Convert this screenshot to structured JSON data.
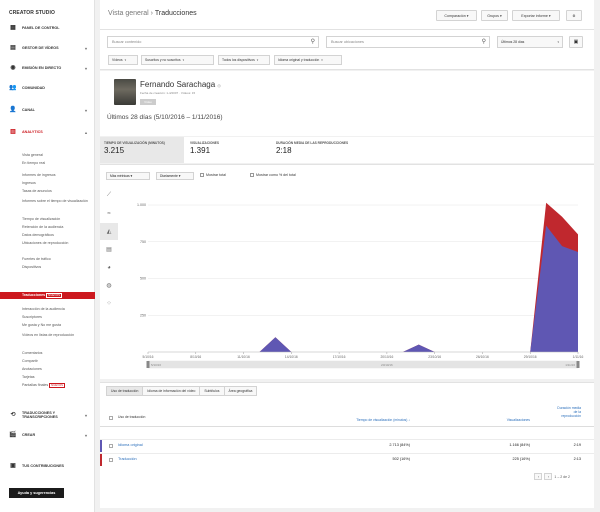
{
  "app": {
    "title": "CREATOR STUDIO"
  },
  "sidebar": {
    "nav": [
      {
        "label": "PANEL DE CONTROL",
        "icon": "dashboard-icon",
        "glyph": "▦"
      },
      {
        "label": "GESTOR DE VÍDEOS",
        "icon": "video-manager-icon",
        "glyph": "▤"
      },
      {
        "label": "EMISIÓN EN DIRECTO",
        "icon": "live-icon",
        "glyph": "◉"
      },
      {
        "label": "COMUNIDAD",
        "icon": "community-icon",
        "glyph": "👥"
      },
      {
        "label": "CANAL",
        "icon": "channel-icon",
        "glyph": "👤"
      },
      {
        "label": "ANALYTICS",
        "icon": "analytics-icon",
        "glyph": "▥"
      }
    ],
    "sub": [
      "Vista general",
      "En tiempo real",
      "Informes de ingresos",
      "Ingresos",
      "Tasas de anuncios",
      "Informes sobre el tiempo de visualización",
      "Tiempo de visualización",
      "Retención de la audiencia",
      "Datos demográficos",
      "Ubicaciones de reproducción",
      "Fuentes de tráfico",
      "Dispositivos",
      "Traducciones",
      "Interacción de la audiencia",
      "Suscriptores",
      "Me gusta y No me gusta",
      "Vídeos en listas de reproducción",
      "Comentarios",
      "Compartir",
      "Anotaciones",
      "Tarjetas",
      "Pantallas finales"
    ],
    "new_badge": "NUEVOS",
    "nav2": [
      {
        "label": "TRADUCCIONES Y TRANSCRIPCIONES",
        "icon": "translate-icon",
        "glyph": "⟲"
      },
      {
        "label": "CREAR",
        "icon": "create-icon",
        "glyph": "🎬"
      },
      {
        "label": "TUS CONTRIBUCIONES",
        "icon": "contributions-icon",
        "glyph": "▣"
      }
    ],
    "help": "Ayuda y sugerencias"
  },
  "header": {
    "crumb": "Vista general",
    "sep": " › ",
    "page": "Traducciones",
    "compare": "Comparación",
    "groups": "Grupos",
    "export": "Exportar informe"
  },
  "filters": {
    "content_placeholder": "Buscar contenido",
    "location_placeholder": "Buscar ubicaciones",
    "range": "Últimos 28 días",
    "chips": [
      "Vídeos",
      "Suscritos y no suscritos",
      "Todos los dispositivos",
      "Idioma original y traducción"
    ]
  },
  "profile": {
    "name": "Fernando Sarachaga",
    "meta": "Fecha de creación: 1-4/2007 · Vídeos: 15",
    "tag": "Vídeo",
    "range": "Últimos 28 días (5/10/2016 – 1/11/2016)"
  },
  "metrics": [
    {
      "label": "TIEMPO DE VISUALIZACIÓN (MINUTOS)",
      "value": "3.215"
    },
    {
      "label": "VISUALIZACIONES",
      "value": "1.391"
    },
    {
      "label": "DURACIÓN MEDIA DE LAS REPRODUCCIONES",
      "value": "2:18"
    }
  ],
  "chart_controls": {
    "more": "Más métricas",
    "order": "Diariamente",
    "show_total": "Mostrar total",
    "show_pct": "Mostrar como % del total"
  },
  "chart_data": {
    "type": "area",
    "x": [
      "5/10/16",
      "6/10/16",
      "7/10/16",
      "8/10/16",
      "9/10/16",
      "10/10/16",
      "11/10/16",
      "12/10/16",
      "13/10/16",
      "14/10/16",
      "15/10/16",
      "16/10/16",
      "17/10/16",
      "18/10/16",
      "19/10/16",
      "20/10/16",
      "21/10/16",
      "22/10/16",
      "23/10/16",
      "24/10/16",
      "25/10/16",
      "26/10/16",
      "27/10/16",
      "28/10/16",
      "29/10/16",
      "30/10/16",
      "31/10/16",
      "1/11/16"
    ],
    "yticks": [
      "1.000",
      "750",
      "500",
      "250"
    ],
    "ylim": [
      0,
      1000
    ],
    "series": [
      {
        "values": [
          0,
          0,
          0,
          0,
          0,
          0,
          0,
          0,
          100,
          0,
          0,
          0,
          0,
          0,
          0,
          0,
          0,
          50,
          0,
          0,
          0,
          0,
          0,
          0,
          0,
          1015,
          920,
          800
        ],
        "color": "#c0282e"
      },
      {
        "values": [
          0,
          0,
          0,
          0,
          0,
          0,
          0,
          0,
          100,
          0,
          0,
          0,
          0,
          0,
          0,
          0,
          0,
          50,
          0,
          0,
          0,
          0,
          0,
          0,
          0,
          860,
          720,
          680
        ],
        "color": "#5f57b3"
      }
    ],
    "xticks": [
      "5/10/16",
      "8/10/16",
      "11/10/16",
      "14/10/16",
      "17/10/16",
      "20/10/16",
      "23/10/16",
      "26/10/16",
      "29/10/16",
      "1/11/16"
    ],
    "nav_labels": [
      "5/10/16",
      "20/10/16",
      "1/11/16"
    ]
  },
  "table": {
    "tabs": [
      "Uso de traducción",
      "Idioma de información del vídeo",
      "Subtítulos",
      "Área geográfica"
    ],
    "headers": [
      "Uso de traducción",
      "Tiempo de visualización (minutos)",
      "Visualizaciones",
      "Duración media de la reproducción"
    ],
    "rows": [
      {
        "name": "Idioma original",
        "watch": "2.713 (84%)",
        "views": "1.166 (84%)",
        "avg": "2:19",
        "color": "#5f57b3"
      },
      {
        "name": "Traducción",
        "watch": "502 (16%)",
        "views": "225 (16%)",
        "avg": "2:13",
        "color": "#c0282e"
      }
    ],
    "pager": "1 – 2 de 2"
  }
}
